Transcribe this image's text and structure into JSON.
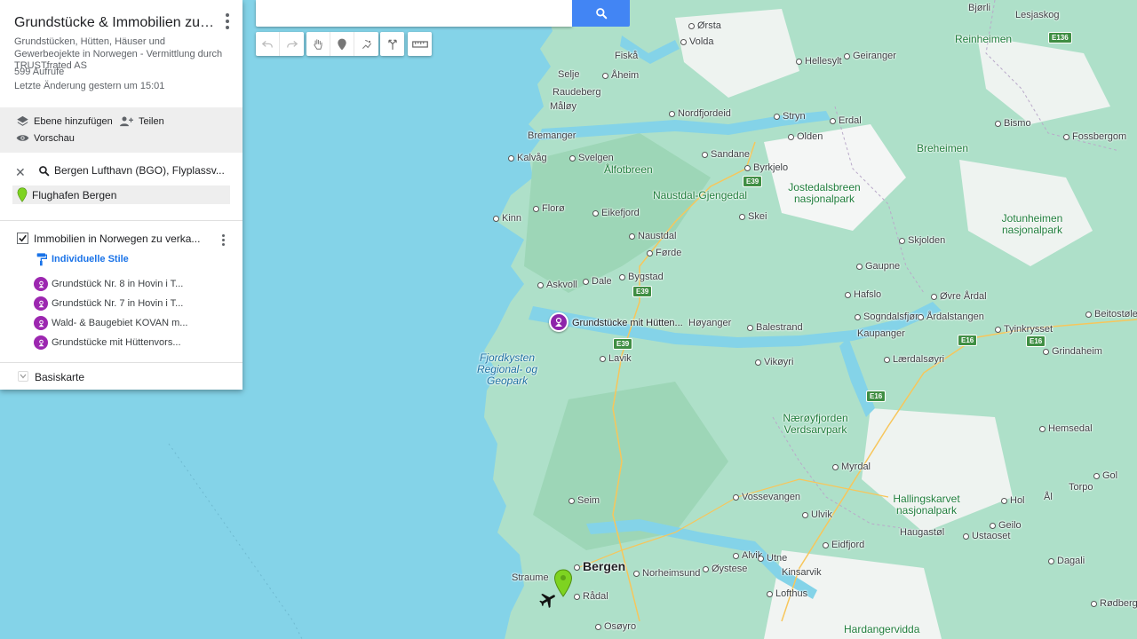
{
  "panel": {
    "title": "Grundstücke & Immobilien zu ver...",
    "description": "Grundstücken, Hütten, Häuser und Gewerbeojekte in Norwegen - Vermittlung durch TRUSTfrated AS",
    "views": "599 Aufrufe",
    "last_modified": "Letzte Änderung gestern um 15:01"
  },
  "actions": {
    "add_layer": "Ebene hinzufügen",
    "share": "Teilen",
    "preview": "Vorschau"
  },
  "search_layer": {
    "query": "Bergen Lufthavn (BGO), Flyplassv...",
    "result": "Flughafen Bergen"
  },
  "layer": {
    "title": "Immobilien in Norwegen zu verka...",
    "checked": true,
    "style_link": "Individuelle Stile",
    "features": [
      "Grundstück Nr. 8 in Hovin i T...",
      "Grundstück Nr. 7 in Hovin i T...",
      "Wald- & Baugebiet KOVAN m...",
      "Grundstücke mit Hüttenvors..."
    ]
  },
  "basemap": {
    "label": "Basiskarte"
  },
  "search": {
    "placeholder": ""
  },
  "map": {
    "marker_label": "Grundstücke mit Hütten...",
    "places": {
      "bjorli": "Bjørli",
      "lesjaskog": "Lesjaskog",
      "reinheimen": "Reinheimen",
      "e136": "E136",
      "orsta": "Ørsta",
      "volda": "Volda",
      "hellesylt": "Hellesylt",
      "geiranger": "Geiranger",
      "fiska": "Fiskå",
      "aheim": "Åheim",
      "selje": "Selje",
      "raudeberg": "Raudeberg",
      "maloy": "Måløy",
      "nordfjordeid": "Nordfjordeid",
      "stryn": "Stryn",
      "erdal": "Erdal",
      "bismo": "Bismo",
      "fossbergom": "Fossbergom",
      "olden": "Olden",
      "breheimen": "Breheimen",
      "bremanger": "Bremanger",
      "kalvag": "Kalvåg",
      "svelgen": "Svelgen",
      "sandane": "Sandane",
      "byrkjelo": "Byrkjelo",
      "alfotbreen": "Ålfotbreen",
      "e39a": "E39",
      "jostedalsbreen": "Jostedalsbreen nasjonalpark",
      "naustdal_gjengedal": "Naustdal-Gjengedal",
      "kinn": "Kinn",
      "floro": "Florø",
      "eikefjord": "Eikefjord",
      "skei": "Skei",
      "jotunheimen": "Jotunheimen nasjonalpark",
      "naustdal": "Naustdal",
      "skjolden": "Skjolden",
      "forde": "Førde",
      "gaupne": "Gaupne",
      "askvoll": "Askvoll",
      "dale": "Dale",
      "bygstad": "Bygstad",
      "e39b": "E39",
      "hafslo": "Hafslo",
      "ovre_ardal": "Øvre Årdal",
      "sogndalsfjora": "Sogndalsfjøra",
      "ardalstangen": "Årdalstangen",
      "beitostolen": "Beitostøle",
      "hoyanger": "Høyanger",
      "balestrand": "Balestrand",
      "kaupanger": "Kaupanger",
      "e16a": "E16",
      "tyinkrysset": "Tyinkrysset",
      "e16b": "E16",
      "grindaheim": "Grindaheim",
      "e39c": "E39",
      "fjordkysten": "Fjordkysten Regional- og Geopark",
      "lavik": "Lavik",
      "vikoyri": "Vikøyri",
      "laerdalsoyri": "Lærdalsøyri",
      "e16c": "E16",
      "naeroyfjorden": "Nærøyfjorden Verdsarvpark",
      "hemsedal": "Hemsedal",
      "myrdal": "Myrdal",
      "gol": "Gol",
      "torpo": "Torpo",
      "seim": "Seim",
      "vossevangen": "Vossevangen",
      "hallingskarvet": "Hallingskarvet nasjonalpark",
      "ulvik": "Ulvik",
      "hol": "Hol",
      "al": "Ål",
      "haugastol": "Haugastøl",
      "geilo": "Geilo",
      "ustaoset": "Ustaoset",
      "alvik": "Alvik",
      "utne": "Utne",
      "eidfjord": "Eidfjord",
      "dagali": "Dagali",
      "bergen": "Bergen",
      "straume": "Straume",
      "norheimsund": "Norheimsund",
      "oystese": "Øystese",
      "kinsarvik": "Kinsarvik",
      "radal": "Rådal",
      "lofthus": "Lofthus",
      "osoyro": "Osøyro",
      "hardangervidda": "Hardangervidda",
      "rodberg": "Rødberg"
    }
  }
}
